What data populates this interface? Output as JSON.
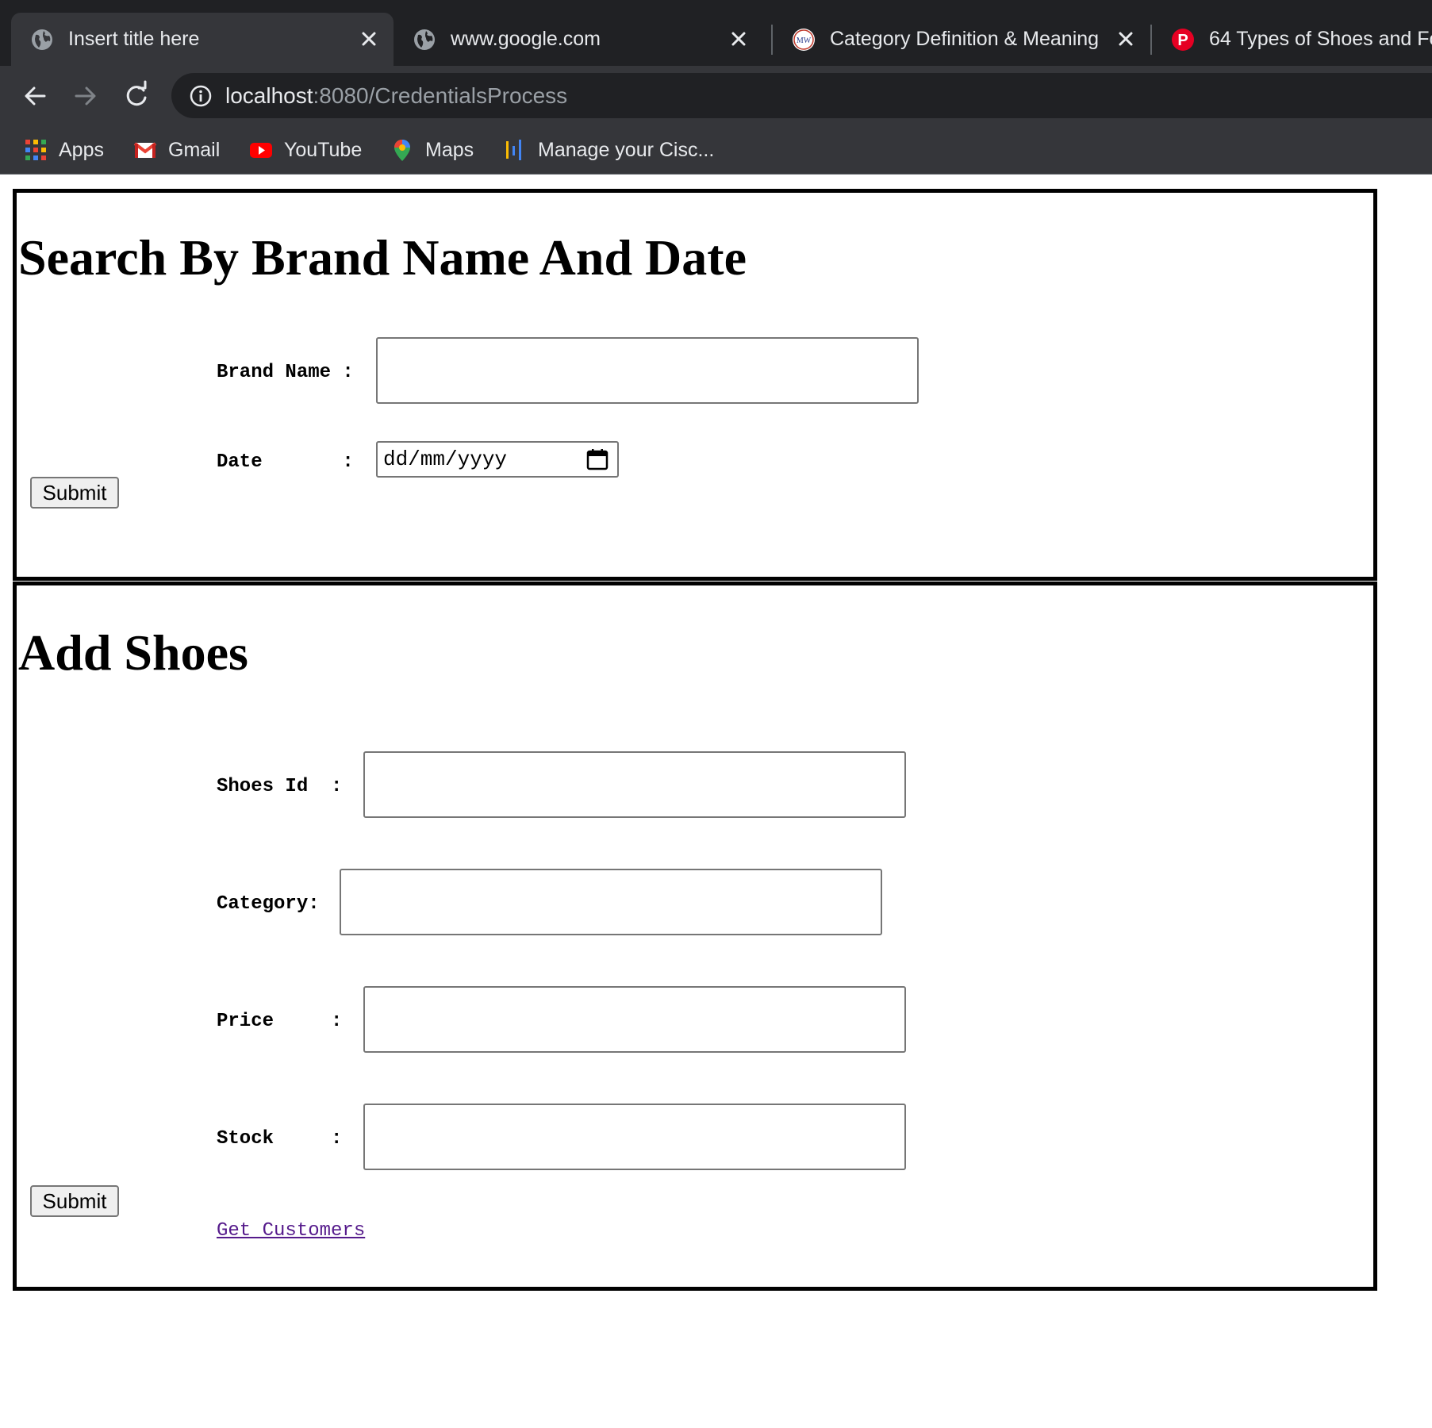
{
  "browser": {
    "tabs": [
      {
        "title": "Insert title here",
        "icon": "globe-icon",
        "active": true
      },
      {
        "title": "www.google.com",
        "icon": "globe-icon",
        "active": false
      },
      {
        "title": "Category Definition & Meaning",
        "icon": "merriam-webster-icon",
        "active": false
      },
      {
        "title": "64 Types of Shoes and Fo",
        "icon": "pinterest-icon",
        "active": false
      }
    ],
    "url": {
      "host": "localhost",
      "path": ":8080/CredentialsProcess"
    },
    "bookmarks": [
      {
        "label": "Apps",
        "icon": "apps-grid-icon"
      },
      {
        "label": "Gmail",
        "icon": "gmail-icon"
      },
      {
        "label": "YouTube",
        "icon": "youtube-icon"
      },
      {
        "label": "Maps",
        "icon": "maps-pin-icon"
      },
      {
        "label": "Manage your Cisc...",
        "icon": "cisco-bars-icon"
      }
    ]
  },
  "search_form": {
    "heading": "Search By Brand Name And Date",
    "brand_label": "Brand Name :",
    "brand_value": "",
    "date_label": "Date       :",
    "date_placeholder": "dd/mm/yyyy",
    "submit_label": "Submit"
  },
  "add_form": {
    "heading": "Add Shoes",
    "shoes_id_label": "Shoes Id  :",
    "category_label": "Category:",
    "price_label": "Price     :",
    "stock_label": "Stock     :",
    "submit_label": "Submit",
    "get_customers_link": "Get Customers"
  },
  "colors": {
    "chrome_dark": "#202124",
    "chrome_toolbar": "#35363a",
    "visited_link": "#551a8b"
  }
}
